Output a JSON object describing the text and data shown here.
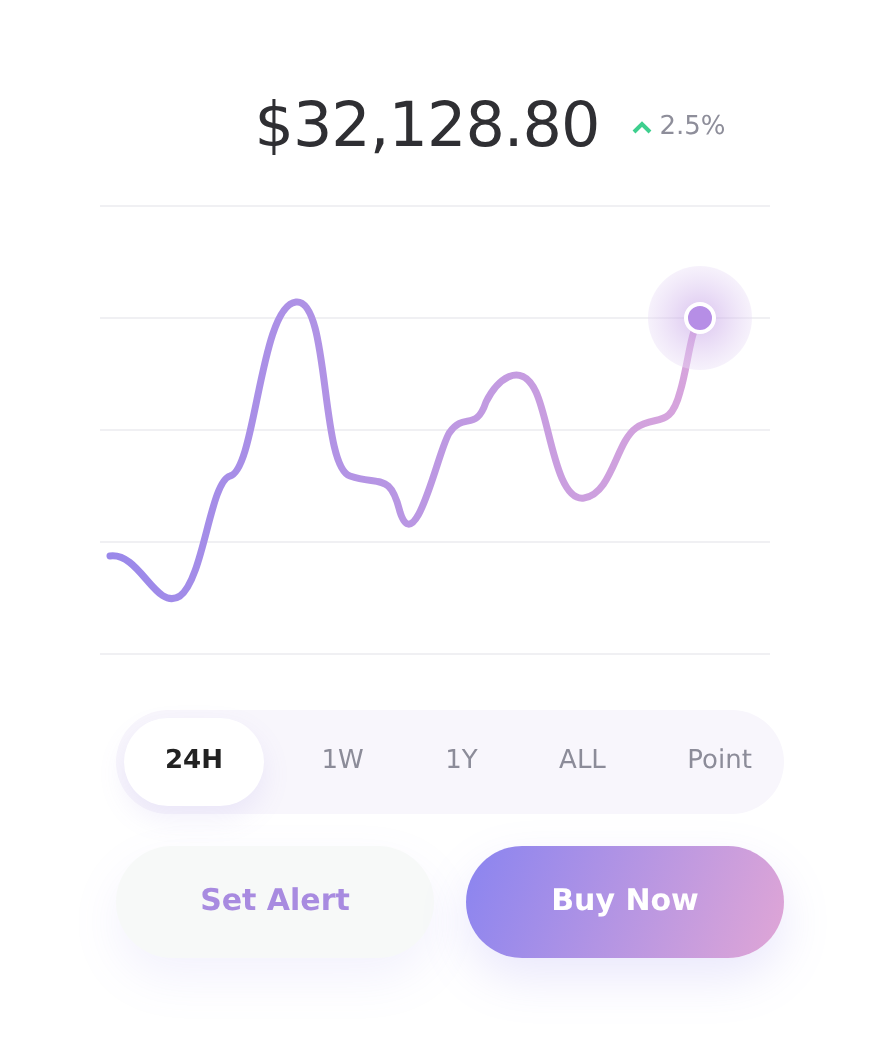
{
  "price": {
    "value": "$32,128.80",
    "change": "2.5%",
    "rising": true
  },
  "ranges": [
    {
      "label": "24H",
      "selected": true
    },
    {
      "label": "1W",
      "selected": false
    },
    {
      "label": "1Y",
      "selected": false
    },
    {
      "label": "ALL",
      "selected": false
    },
    {
      "label": "Point",
      "selected": false
    }
  ],
  "buttons": [
    {
      "label": "Set Alert",
      "kind": "secondary"
    },
    {
      "label": "Buy Now",
      "kind": "primary"
    }
  ]
}
